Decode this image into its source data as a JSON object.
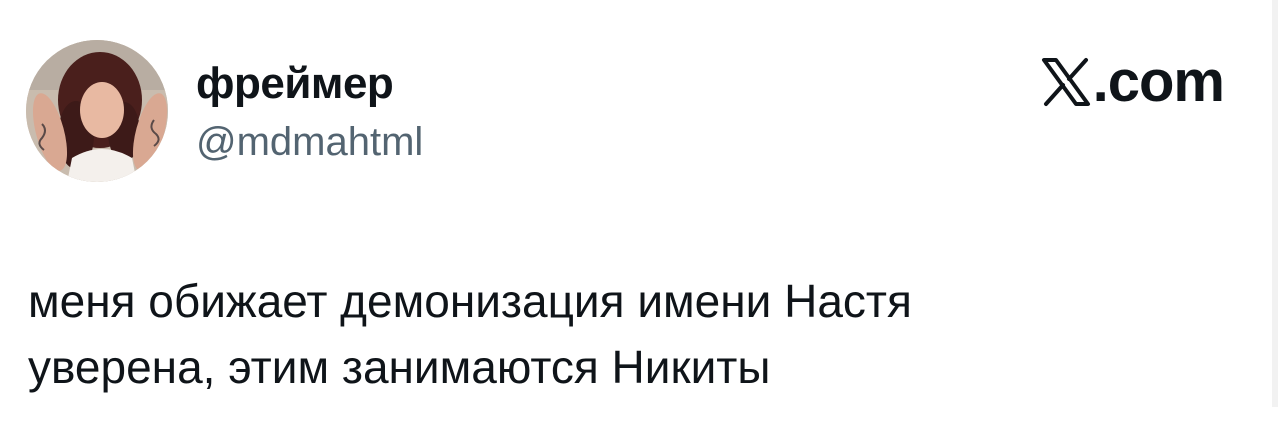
{
  "author": {
    "display_name": "фреймер",
    "handle": "@mdmahtml",
    "avatar_icon": "profile-photo"
  },
  "brand": {
    "logo_icon": "x-logo-icon",
    "text": ".com"
  },
  "tweet": {
    "lines": [
      "меня обижает демонизация имени Настя",
      "уверена, этим занимаются Никиты"
    ]
  },
  "colors": {
    "text_primary": "#0f1419",
    "text_secondary": "#536471",
    "background": "#ffffff"
  }
}
